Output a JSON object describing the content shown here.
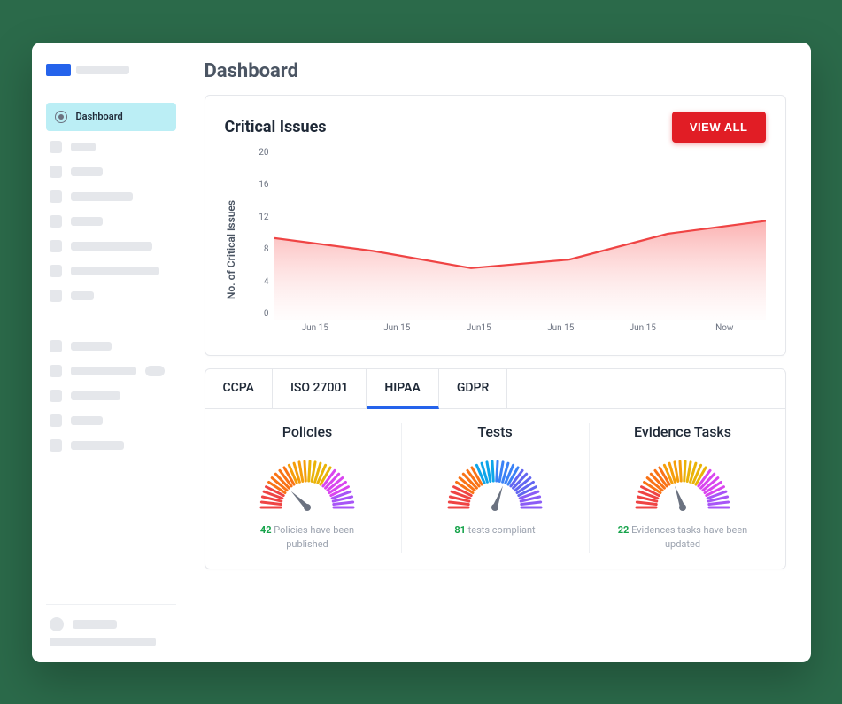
{
  "sidebar": {
    "active_item": {
      "label": "Dashboard"
    }
  },
  "page": {
    "title": "Dashboard"
  },
  "critical_issues": {
    "title": "Critical Issues",
    "button": "VIEW ALL",
    "ylabel": "No. of Critical Issues",
    "yticks": [
      "20",
      "16",
      "12",
      "8",
      "4",
      "0"
    ],
    "xticks": [
      "Jun 15",
      "Jun 15",
      "Jun15",
      "Jun 15",
      "Jun 15",
      "Now"
    ]
  },
  "chart_data": {
    "type": "area",
    "title": "Critical Issues",
    "ylabel": "No. of Critical Issues",
    "ylim": [
      0,
      20
    ],
    "categories": [
      "Jun 15",
      "Jun 15",
      "Jun15",
      "Jun 15",
      "Jun 15",
      "Now"
    ],
    "values": [
      9.5,
      8,
      6,
      7,
      10,
      11.5
    ]
  },
  "compliance": {
    "tabs": [
      "CCPA",
      "ISO 27001",
      "HIPAA",
      "GDPR"
    ],
    "active_tab_index": 2,
    "gauges": [
      {
        "title": "Policies",
        "value": 42,
        "suffix": " Policies have been published",
        "needle_deg": -45,
        "palette": "warm"
      },
      {
        "title": "Tests",
        "value": 81,
        "suffix": " tests compliant",
        "needle_deg": 20,
        "palette": "cool"
      },
      {
        "title": "Evidence Tasks",
        "value": 22,
        "suffix": " Evidences tasks have been updated",
        "needle_deg": -20,
        "palette": "warm"
      }
    ]
  }
}
